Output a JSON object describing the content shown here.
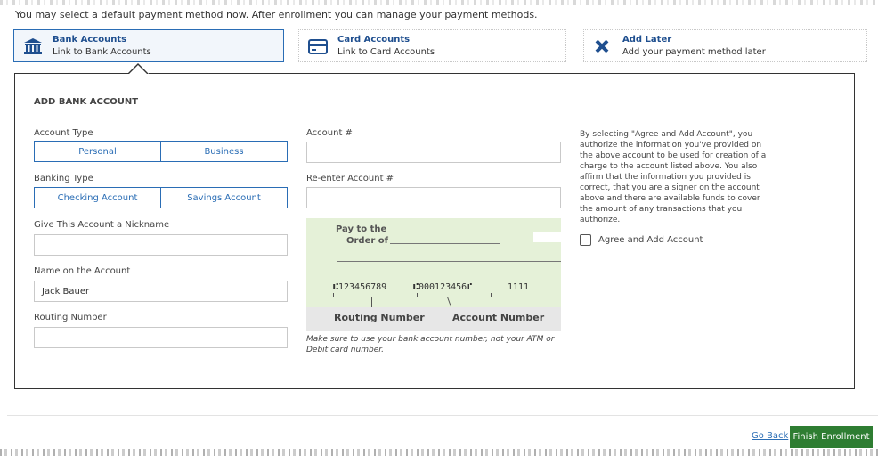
{
  "intro_text": "You may select a default payment method now. After enrollment you can manage your payment methods.",
  "payment_methods": [
    {
      "title": "Bank Accounts",
      "subtitle": "Link to Bank Accounts",
      "icon": "bank-icon",
      "selected": true
    },
    {
      "title": "Card Accounts",
      "subtitle": "Link to Card Accounts",
      "icon": "card-icon",
      "selected": false
    },
    {
      "title": "Add Later",
      "subtitle": "Add your payment method later",
      "icon": "close-x-icon",
      "selected": false
    }
  ],
  "form": {
    "section_title": "ADD BANK ACCOUNT",
    "account_type": {
      "label": "Account Type",
      "options": [
        "Personal",
        "Business"
      ]
    },
    "banking_type": {
      "label": "Banking Type",
      "options": [
        "Checking Account",
        "Savings Account"
      ]
    },
    "nickname": {
      "label": "Give This Account a Nickname",
      "value": ""
    },
    "name_on_account": {
      "label": "Name on the Account",
      "value": "Jack Bauer"
    },
    "routing_number": {
      "label": "Routing Number",
      "value": ""
    },
    "account_number": {
      "label": "Account #",
      "value": ""
    },
    "reenter_account_number": {
      "label": "Re-enter Account #",
      "value": ""
    }
  },
  "check_image": {
    "pay_to": "Pay to the",
    "order_of": "Order of",
    "routing_micr": "⑆123456789",
    "account_micr": "⑆000123456⑈",
    "check_no": "1111",
    "routing_label": "Routing Number",
    "account_label": "Account Number",
    "note": "Make sure to use your bank account number, not your ATM or Debit card number."
  },
  "legal_text": "By selecting \"Agree and Add Account\", you authorize the information you've provided on the above account to be used for creation of a charge to the account listed above. You also affirm that the information you provided is correct, that you are a signer on the account above and there are available funds to cover the amount of any transactions that you authorize.",
  "agree_label": "Agree and Add Account",
  "footer": {
    "go_back": "Go Back",
    "finish": "Finish Enrollment"
  },
  "colors": {
    "accent": "#2a6db5",
    "finish_button": "#2e7d32",
    "check_bg": "#e5f1d8"
  }
}
